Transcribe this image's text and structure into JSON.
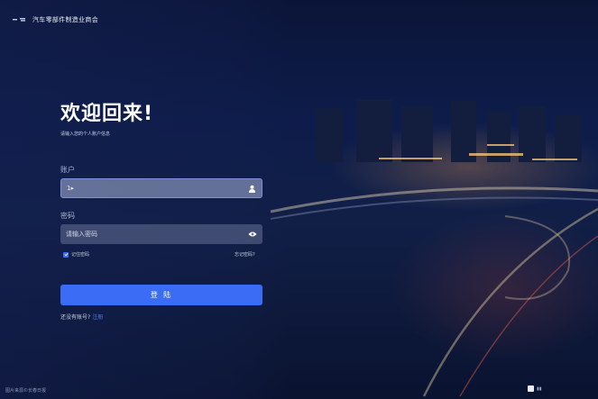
{
  "brand": {
    "name": "汽车零部件制造业商会"
  },
  "login": {
    "title": "欢迎回来!",
    "subtitle": "请输入您的个人账户信息",
    "account_label": "账户",
    "account_value": "1▸",
    "password_label": "密码",
    "password_placeholder": "请输入密码",
    "remember_label": "记住密码",
    "forgot_label": "忘记密码?",
    "login_button": "登 陆",
    "register_prompt": "还没有账号?",
    "register_link": "注册"
  },
  "footer": {
    "credit": "图片来源©长春日报",
    "corner_text": "▮▮"
  },
  "icons": {
    "user": "user-icon",
    "eye": "eye-icon",
    "check": "checkmark-icon"
  },
  "colors": {
    "accent": "#3b6cf6",
    "link": "#4d7cf4"
  }
}
